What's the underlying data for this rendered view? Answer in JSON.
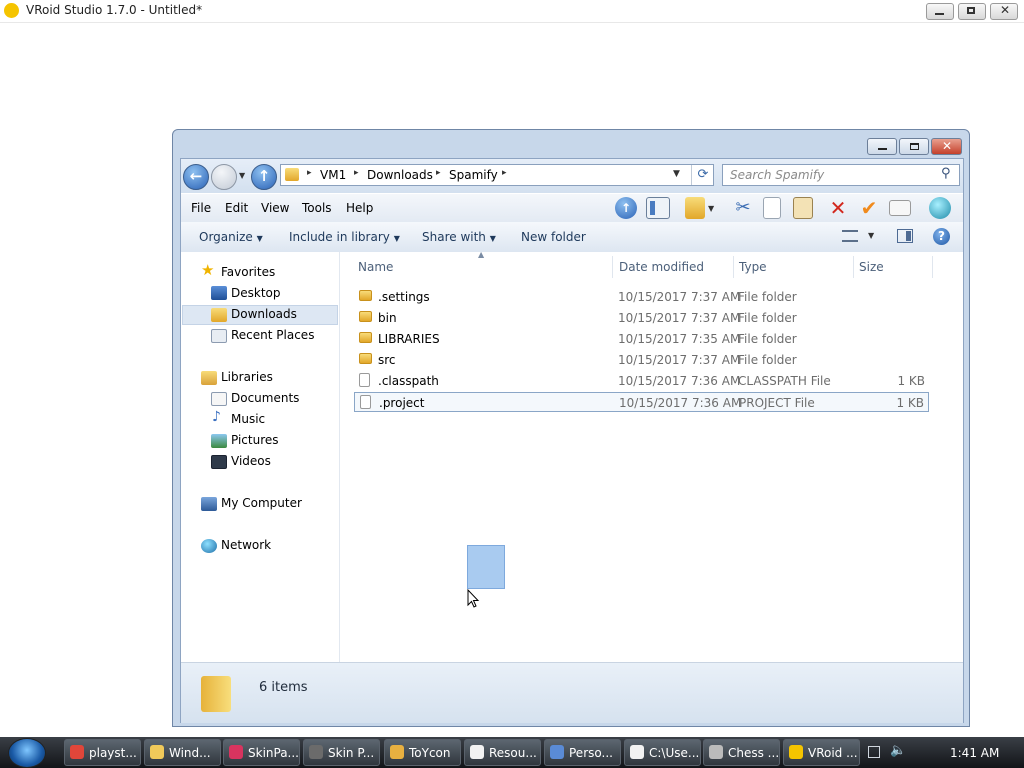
{
  "vroid": {
    "title": "VRoid Studio 1.7.0 - Untitled*"
  },
  "explorer": {
    "address": {
      "crumbs": [
        "VM1",
        "Downloads",
        "Spamify"
      ]
    },
    "search": {
      "placeholder": "Search Spamify"
    },
    "menu": [
      "File",
      "Edit",
      "View",
      "Tools",
      "Help"
    ],
    "commands": {
      "organize": "Organize",
      "include": "Include in library",
      "share": "Share with",
      "new_folder": "New folder"
    },
    "nav": {
      "favorites": "Favorites",
      "desktop": "Desktop",
      "downloads": "Downloads",
      "recent": "Recent Places",
      "libraries": "Libraries",
      "documents": "Documents",
      "music": "Music",
      "pictures": "Pictures",
      "videos": "Videos",
      "computer": "My Computer",
      "network": "Network"
    },
    "columns": {
      "name": "Name",
      "date": "Date modified",
      "type": "Type",
      "size": "Size"
    },
    "files": [
      {
        "name": ".settings",
        "date": "10/15/2017 7:37 AM",
        "type": "File folder",
        "size": "",
        "kind": "folder"
      },
      {
        "name": "bin",
        "date": "10/15/2017 7:37 AM",
        "type": "File folder",
        "size": "",
        "kind": "folder"
      },
      {
        "name": "LIBRARIES",
        "date": "10/15/2017 7:35 AM",
        "type": "File folder",
        "size": "",
        "kind": "folder"
      },
      {
        "name": "src",
        "date": "10/15/2017 7:37 AM",
        "type": "File folder",
        "size": "",
        "kind": "folder"
      },
      {
        "name": ".classpath",
        "date": "10/15/2017 7:36 AM",
        "type": "CLASSPATH File",
        "size": "1 KB",
        "kind": "file"
      },
      {
        "name": ".project",
        "date": "10/15/2017 7:36 AM",
        "type": "PROJECT File",
        "size": "1 KB",
        "kind": "file"
      }
    ],
    "status": {
      "count": "6 items"
    }
  },
  "taskbar": {
    "tasks": [
      {
        "label": "playst...",
        "color": "#e0463a"
      },
      {
        "label": "Wind...",
        "color": "#f0c95a"
      },
      {
        "label": "SkinPa...",
        "color": "#d8345f"
      },
      {
        "label": "Skin P...",
        "color": "#6b6b6b"
      },
      {
        "label": "ToYcon",
        "color": "#e8b040"
      },
      {
        "label": "Resou...",
        "color": "#f2f2f2"
      },
      {
        "label": "Perso...",
        "color": "#5a8bd6"
      },
      {
        "label": "C:\\Use...",
        "color": "#f2f2f2"
      },
      {
        "label": "Chess ...",
        "color": "#bbbbbb"
      },
      {
        "label": "VRoid ...",
        "color": "#f5c400"
      }
    ],
    "clock": "1:41 AM"
  }
}
